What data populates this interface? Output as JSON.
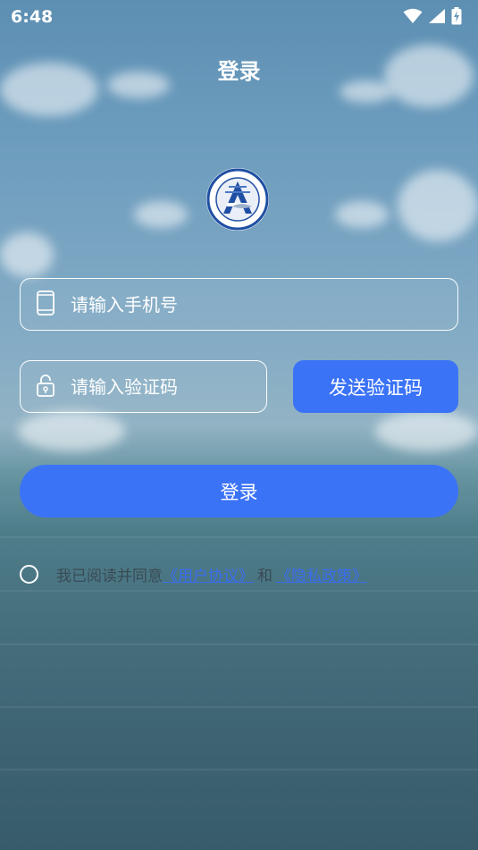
{
  "status_bar": {
    "time": "6:48"
  },
  "header": {
    "title": "登录"
  },
  "form": {
    "phone_placeholder": "请输入手机号",
    "code_placeholder": "请输入验证码",
    "send_code_label": "发送验证码",
    "login_label": "登录"
  },
  "agreement": {
    "prefix": "我已阅读并同意",
    "user_agreement": "《用户协议》",
    "and": "和",
    "privacy_policy": "《隐私政策》",
    "checked": false
  },
  "colors": {
    "accent": "#3b73f7",
    "link": "#3a6ef0"
  },
  "icons": {
    "phone_field": "smartphone-icon",
    "code_field": "lock-icon",
    "status": [
      "wifi-icon",
      "signal-icon",
      "battery-charging-icon"
    ]
  }
}
